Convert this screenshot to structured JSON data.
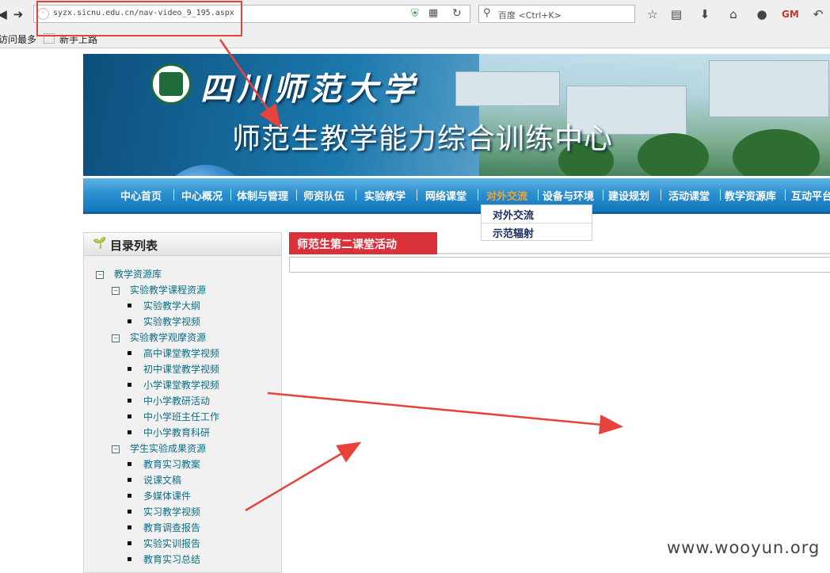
{
  "browser": {
    "url": "syzx.sicnu.edu.cn/nav-video_9_195.aspx",
    "search_placeholder": "百度 <Ctrl+K>",
    "bookmarks": [
      "访问最多",
      "新手上路"
    ]
  },
  "header": {
    "university_name": "四川师范大学",
    "center_name": "师范生教学能力综合训练中心"
  },
  "nav": {
    "items": [
      "中心首页",
      "中心概况",
      "体制与管理",
      "师资队伍",
      "实验教学",
      "网络课堂",
      "对外交流",
      "设备与环境",
      "建设规划",
      "活动课堂",
      "教学资源库",
      "互动平台"
    ],
    "active_index": 6,
    "dropdown": [
      "对外交流",
      "示范辐射"
    ]
  },
  "sidebar": {
    "title": "目录列表",
    "tree": [
      {
        "level": 0,
        "label": "教学资源库",
        "expandable": true
      },
      {
        "level": 1,
        "label": "实验教学课程资源",
        "expandable": true
      },
      {
        "level": 2,
        "label": "实验教学大纲"
      },
      {
        "level": 2,
        "label": "实验教学视频"
      },
      {
        "level": 1,
        "label": "实验教学观摩资源",
        "expandable": true
      },
      {
        "level": 2,
        "label": "高中课堂教学视频"
      },
      {
        "level": 2,
        "label": "初中课堂教学视频"
      },
      {
        "level": 2,
        "label": "小学课堂教学视频"
      },
      {
        "level": 2,
        "label": "中小学教研活动"
      },
      {
        "level": 2,
        "label": "中小学班主任工作"
      },
      {
        "level": 2,
        "label": "中小学教育科研"
      },
      {
        "level": 1,
        "label": "学生实验成果资源",
        "expandable": true
      },
      {
        "level": 2,
        "label": "教育实习教案"
      },
      {
        "level": 2,
        "label": "说课文稿"
      },
      {
        "level": 2,
        "label": "多媒体课件"
      },
      {
        "level": 2,
        "label": "实习教学视频"
      },
      {
        "level": 2,
        "label": "教育调查报告"
      },
      {
        "level": 2,
        "label": "实验实训报告"
      },
      {
        "level": 2,
        "label": "教育实习总结"
      }
    ]
  },
  "content": {
    "tab_title": "师范生第二课堂活动"
  },
  "watermark": "www.wooyun.org",
  "colors": {
    "menu_blue": "#1e86c8",
    "active_orange": "#f0a33c",
    "tab_red": "#d9303a",
    "tree_link": "#0b6e87",
    "annotation_red": "#e8433a"
  }
}
